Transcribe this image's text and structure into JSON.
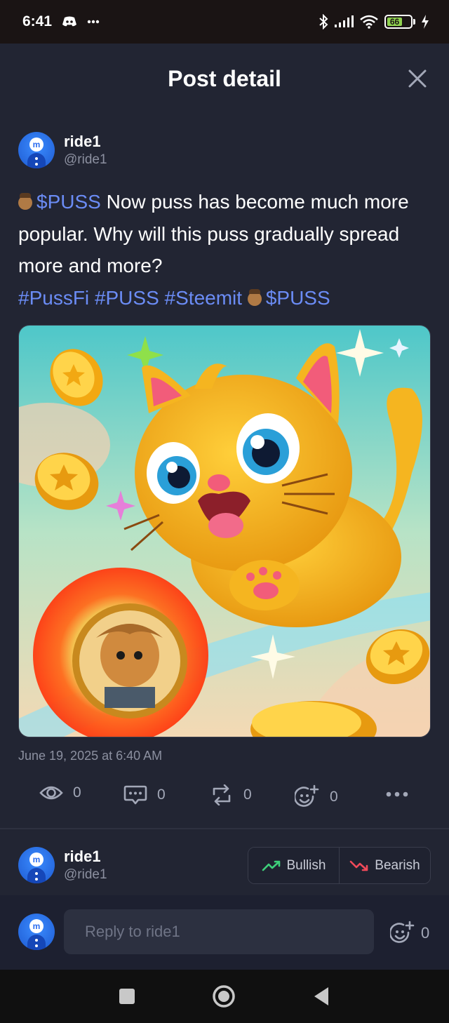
{
  "status_bar": {
    "time": "6:41",
    "battery": "66"
  },
  "header": {
    "title": "Post detail"
  },
  "post": {
    "author_name": "ride1",
    "author_handle": "@ride1",
    "ticker": "$PUSS",
    "text": " Now puss has become much more popular. Why will this puss gradually spread more and more?",
    "tags": [
      "#PussFi",
      "#PUSS",
      "#Steemit"
    ],
    "ticker2": "$PUSS",
    "timestamp": "June 19, 2025 at 6:40 AM",
    "stats": {
      "views": "0",
      "comments": "0",
      "reposts": "0",
      "reactions": "0"
    }
  },
  "sentiment": {
    "author_name": "ride1",
    "author_handle": "@ride1",
    "bullish_label": "Bullish",
    "bearish_label": "Bearish"
  },
  "reply": {
    "placeholder": "Reply to ride1",
    "reaction_count": "0"
  },
  "colors": {
    "accent": "#6b8cf5",
    "bullish": "#3ecf7a",
    "bearish": "#f04a5a"
  }
}
